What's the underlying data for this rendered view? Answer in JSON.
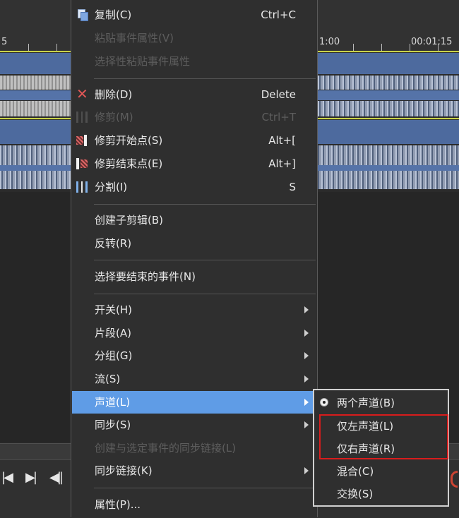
{
  "timeline": {
    "ruler_labels": [
      "5",
      "1:00",
      "00:01:15"
    ]
  },
  "transport": {
    "buttons": [
      "|◀",
      "▶|",
      "◀||"
    ]
  },
  "context_menu": {
    "items": [
      {
        "label": "复制(C)",
        "shortcut": "Ctrl+C",
        "icon": "copy-icon",
        "enabled": true
      },
      {
        "label": "粘贴事件属性(V)",
        "shortcut": "",
        "enabled": false
      },
      {
        "label": "选择性粘贴事件属性",
        "shortcut": "",
        "enabled": false
      },
      {
        "label": "删除(D)",
        "shortcut": "Delete",
        "icon": "delete-icon",
        "enabled": true
      },
      {
        "label": "修剪(M)",
        "shortcut": "Ctrl+T",
        "icon": "trim-icon",
        "enabled": false
      },
      {
        "label": "修剪开始点(S)",
        "shortcut": "Alt+[",
        "icon": "trim-start-icon",
        "enabled": true
      },
      {
        "label": "修剪结束点(E)",
        "shortcut": "Alt+]",
        "icon": "trim-end-icon",
        "enabled": true
      },
      {
        "label": "分割(I)",
        "shortcut": "S",
        "icon": "split-icon",
        "enabled": true
      },
      {
        "label": "创建子剪辑(B)",
        "shortcut": "",
        "enabled": true
      },
      {
        "label": "反转(R)",
        "shortcut": "",
        "enabled": true
      },
      {
        "label": "选择要结束的事件(N)",
        "shortcut": "",
        "enabled": true
      },
      {
        "label": "开关(H)",
        "submenu": true,
        "enabled": true
      },
      {
        "label": "片段(A)",
        "submenu": true,
        "enabled": true
      },
      {
        "label": "分组(G)",
        "submenu": true,
        "enabled": true
      },
      {
        "label": "流(S)",
        "submenu": true,
        "enabled": true
      },
      {
        "label": "声道(L)",
        "submenu": true,
        "enabled": true,
        "highlighted": true
      },
      {
        "label": "同步(S)",
        "submenu": true,
        "enabled": true
      },
      {
        "label": "创建与选定事件的同步链接(L)",
        "shortcut": "",
        "enabled": false
      },
      {
        "label": "同步链接(K)",
        "submenu": true,
        "enabled": true
      },
      {
        "label": "属性(P)...",
        "shortcut": "",
        "enabled": true
      }
    ]
  },
  "channel_submenu": {
    "items": [
      {
        "label": "两个声道(B)",
        "selected": true
      },
      {
        "label": "仅左声道(L)",
        "selected": false
      },
      {
        "label": "仅右声道(R)",
        "selected": false
      },
      {
        "label": "混合(C)",
        "selected": false
      },
      {
        "label": "交换(S)",
        "selected": false
      }
    ]
  },
  "colors": {
    "menu_highlight": "#5f9ce6",
    "annotation_box": "#d81c1c",
    "clip": "#4d6a9e"
  }
}
